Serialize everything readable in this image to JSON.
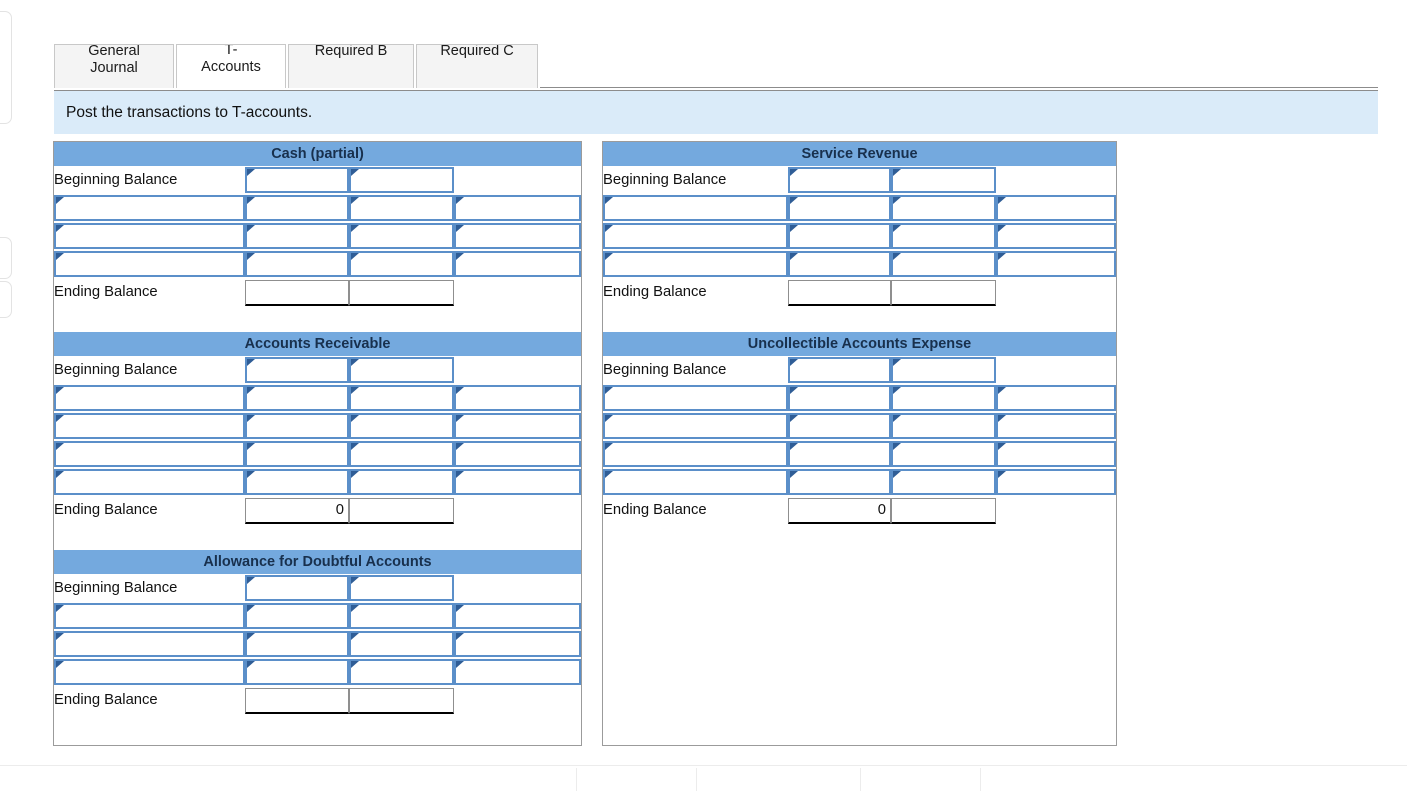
{
  "tabs": [
    {
      "id": "general-journal",
      "label": "General\nJournal",
      "active": false
    },
    {
      "id": "t-accounts",
      "label": "T-\nAccounts",
      "active": true
    },
    {
      "id": "required-b",
      "label": "Required B",
      "active": false
    },
    {
      "id": "required-c",
      "label": "Required C",
      "active": false
    }
  ],
  "instruction": {
    "text": "Post the transactions to T-accounts."
  },
  "labels": {
    "beginning_balance": "Beginning Balance",
    "ending_balance": "Ending Balance"
  },
  "colors": {
    "account_header_bg": "#74A9DE",
    "instruction_bg": "#DAEBF9",
    "input_border": "#5B8FC9",
    "input_marker": "#2F5D96",
    "grid_border": "#9B9B9B",
    "active_tab_bg": "#FFFFFF",
    "inactive_tab_bg": "#F4F4F4"
  },
  "accounts": {
    "cash_partial": {
      "title": "Cash (partial)",
      "beginning_balance_label": "Beginning Balance",
      "beginning_debit": "",
      "beginning_credit": "",
      "rows": [
        {
          "desc": "",
          "debit": "",
          "credit": "",
          "extra": ""
        },
        {
          "desc": "",
          "debit": "",
          "credit": "",
          "extra": ""
        },
        {
          "desc": "",
          "debit": "",
          "credit": "",
          "extra": ""
        }
      ],
      "ending_balance_label": "Ending Balance",
      "ending_debit": "",
      "ending_credit": ""
    },
    "accounts_receivable": {
      "title": "Accounts Receivable",
      "beginning_balance_label": "Beginning Balance",
      "beginning_debit": "",
      "beginning_credit": "",
      "rows": [
        {
          "desc": "",
          "debit": "",
          "credit": "",
          "extra": ""
        },
        {
          "desc": "",
          "debit": "",
          "credit": "",
          "extra": ""
        },
        {
          "desc": "",
          "debit": "",
          "credit": "",
          "extra": ""
        },
        {
          "desc": "",
          "debit": "",
          "credit": "",
          "extra": ""
        }
      ],
      "ending_balance_label": "Ending Balance",
      "ending_debit": "0",
      "ending_credit": ""
    },
    "allowance_for_doubtful_accounts": {
      "title": "Allowance for Doubtful Accounts",
      "beginning_balance_label": "Beginning Balance",
      "beginning_debit": "",
      "beginning_credit": "",
      "rows": [
        {
          "desc": "",
          "debit": "",
          "credit": "",
          "extra": ""
        },
        {
          "desc": "",
          "debit": "",
          "credit": "",
          "extra": ""
        },
        {
          "desc": "",
          "debit": "",
          "credit": "",
          "extra": ""
        }
      ],
      "ending_balance_label": "Ending Balance",
      "ending_debit": "",
      "ending_credit": ""
    },
    "service_revenue": {
      "title": "Service Revenue",
      "beginning_balance_label": "Beginning Balance",
      "beginning_debit": "",
      "beginning_credit": "",
      "rows": [
        {
          "desc": "",
          "debit": "",
          "credit": "",
          "extra": ""
        },
        {
          "desc": "",
          "debit": "",
          "credit": "",
          "extra": ""
        },
        {
          "desc": "",
          "debit": "",
          "credit": "",
          "extra": ""
        }
      ],
      "ending_balance_label": "Ending Balance",
      "ending_debit": "",
      "ending_credit": ""
    },
    "uncollectible_accounts_expense": {
      "title": "Uncollectible Accounts Expense",
      "beginning_balance_label": "Beginning Balance",
      "beginning_debit": "",
      "beginning_credit": "",
      "rows": [
        {
          "desc": "",
          "debit": "",
          "credit": "",
          "extra": ""
        },
        {
          "desc": "",
          "debit": "",
          "credit": "",
          "extra": ""
        },
        {
          "desc": "",
          "debit": "",
          "credit": "",
          "extra": ""
        },
        {
          "desc": "",
          "debit": "",
          "credit": "",
          "extra": ""
        }
      ],
      "ending_balance_label": "Ending Balance",
      "ending_debit": "0",
      "ending_credit": ""
    }
  }
}
